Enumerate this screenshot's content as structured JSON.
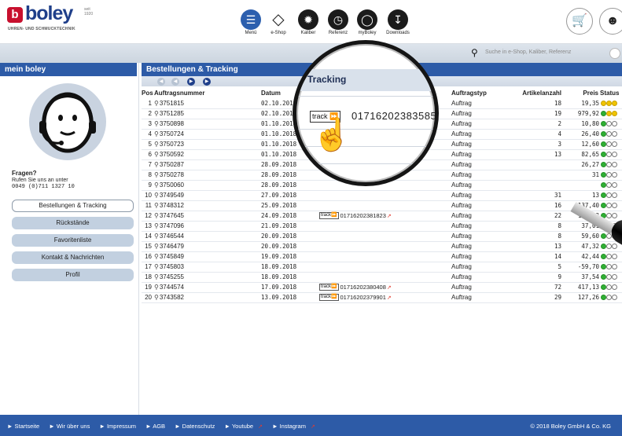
{
  "brand": {
    "logo_letter": "b",
    "name": "boley",
    "since": "seit 1920",
    "tagline": "UHREN- UND SCHMUCKTECHNIK",
    "color_primary": "#2d5ba7",
    "color_red": "#c8102e"
  },
  "nav": [
    {
      "label": "Menü",
      "icon": "menu-icon"
    },
    {
      "label": "e-Shop",
      "icon": "diamond-icon"
    },
    {
      "label": "Kaliber",
      "icon": "gear-icon"
    },
    {
      "label": "Referenz",
      "icon": "clock-icon"
    },
    {
      "label": "myBoley",
      "icon": "boley-o-icon"
    },
    {
      "label": "Downloads",
      "icon": "download-icon"
    }
  ],
  "header_buttons": [
    {
      "icon": "cart-icon"
    },
    {
      "icon": "user-icon"
    }
  ],
  "search": {
    "placeholder": "Suche in e-Shop, Kaliber, Referenz"
  },
  "sidebar": {
    "title": "mein boley",
    "help_title": "Fragen?",
    "help_text": "Rufen Sie uns an unter",
    "phone": "0049 (0)711 1327 10",
    "items": [
      {
        "label": "Bestellungen & Tracking",
        "active": true
      },
      {
        "label": "Rückstände",
        "active": false
      },
      {
        "label": "Favoritenliste",
        "active": false
      },
      {
        "label": "Kontakt & Nachrichten",
        "active": false
      },
      {
        "label": "Profil",
        "active": false
      }
    ]
  },
  "main": {
    "title": "Bestellungen & Tracking",
    "columns": {
      "pos": "Pos",
      "order": "Auftragsnummer",
      "date": "Datum",
      "type": "Auftragstyp",
      "count": "Artikelanzahl",
      "price": "Preis",
      "status": "Status"
    },
    "track_label": "track",
    "rows": [
      {
        "pos": "1",
        "order": "3751815",
        "date": "02.10.2018",
        "tracking": "",
        "type": "Auftrag",
        "count": "18",
        "price": "19,35",
        "status": [
          "y",
          "y",
          "y"
        ]
      },
      {
        "pos": "2",
        "order": "3751285",
        "date": "02.10.2018",
        "tracking": "",
        "type": "Auftrag",
        "count": "19",
        "price": "979,92",
        "status": [
          "g",
          "y",
          "y"
        ]
      },
      {
        "pos": "3",
        "order": "3750898",
        "date": "01.10.2018",
        "tracking": "",
        "type": "Auftrag",
        "count": "2",
        "price": "10,80",
        "status": [
          "g",
          "e",
          "e"
        ]
      },
      {
        "pos": "4",
        "order": "3750724",
        "date": "01.10.2018",
        "tracking": "",
        "type": "Auftrag",
        "count": "4",
        "price": "26,40",
        "status": [
          "g",
          "e",
          "e"
        ]
      },
      {
        "pos": "5",
        "order": "3750723",
        "date": "01.10.2018",
        "tracking": "",
        "type": "Auftrag",
        "count": "3",
        "price": "12,60",
        "status": [
          "g",
          "e",
          "e"
        ]
      },
      {
        "pos": "6",
        "order": "3750592",
        "date": "01.10.2018",
        "tracking": "",
        "type": "Auftrag",
        "count": "13",
        "price": "82,65",
        "status": [
          "g",
          "e",
          "e"
        ]
      },
      {
        "pos": "7",
        "order": "3750287",
        "date": "28.09.2018",
        "tracking": "",
        "type": "Auftrag",
        "count": "",
        "price": "26,27",
        "status": [
          "g",
          "e",
          "e"
        ]
      },
      {
        "pos": "8",
        "order": "3750278",
        "date": "28.09.2018",
        "tracking": "",
        "type": "Auftrag",
        "count": "",
        "price": "31",
        "status": [
          "g",
          "e",
          "e"
        ]
      },
      {
        "pos": "9",
        "order": "3750060",
        "date": "28.09.2018",
        "tracking": "",
        "type": "Auftrag",
        "count": "",
        "price": "",
        "status": [
          "g",
          "e",
          "e"
        ]
      },
      {
        "pos": "10",
        "order": "3749549",
        "date": "27.09.2018",
        "tracking": "",
        "type": "Auftrag",
        "count": "31",
        "price": "13",
        "status": [
          "g",
          "e",
          "e"
        ]
      },
      {
        "pos": "11",
        "order": "3748312",
        "date": "25.09.2018",
        "tracking": "",
        "type": "Auftrag",
        "count": "16",
        "price": "137,40",
        "status": [
          "g",
          "e",
          "e"
        ]
      },
      {
        "pos": "12",
        "order": "3747645",
        "date": "24.09.2018",
        "tracking": "01716202381823",
        "type": "Auftrag",
        "count": "22",
        "price": "166,63",
        "status": [
          "g",
          "e",
          "e"
        ]
      },
      {
        "pos": "13",
        "order": "3747096",
        "date": "21.09.2018",
        "tracking": "",
        "type": "Auftrag",
        "count": "8",
        "price": "37,01",
        "status": [
          "g",
          "e",
          "e"
        ]
      },
      {
        "pos": "14",
        "order": "3746544",
        "date": "20.09.2018",
        "tracking": "",
        "type": "Auftrag",
        "count": "8",
        "price": "59,60",
        "status": [
          "g",
          "e",
          "e"
        ]
      },
      {
        "pos": "15",
        "order": "3746479",
        "date": "20.09.2018",
        "tracking": "",
        "type": "Auftrag",
        "count": "13",
        "price": "47,32",
        "status": [
          "g",
          "e",
          "e"
        ]
      },
      {
        "pos": "16",
        "order": "3745849",
        "date": "19.09.2018",
        "tracking": "",
        "type": "Auftrag",
        "count": "14",
        "price": "42,44",
        "status": [
          "g",
          "e",
          "e"
        ]
      },
      {
        "pos": "17",
        "order": "3745803",
        "date": "18.09.2018",
        "tracking": "",
        "type": "Auftrag",
        "count": "5",
        "price": "-59,70",
        "status": [
          "g",
          "e",
          "e"
        ]
      },
      {
        "pos": "18",
        "order": "3745255",
        "date": "18.09.2018",
        "tracking": "",
        "type": "Auftrag",
        "count": "9",
        "price": "37,54",
        "status": [
          "g",
          "e",
          "e"
        ]
      },
      {
        "pos": "19",
        "order": "3744574",
        "date": "17.09.2018",
        "tracking": "01716202380408",
        "type": "Auftrag",
        "count": "72",
        "price": "417,13",
        "status": [
          "g",
          "e",
          "e"
        ]
      },
      {
        "pos": "20",
        "order": "3743582",
        "date": "13.09.2018",
        "tracking": "01716202379901",
        "type": "Auftrag",
        "count": "29",
        "price": "127,26",
        "status": [
          "g",
          "e",
          "e"
        ]
      }
    ]
  },
  "magnifier": {
    "title": "Tracking",
    "track_label": "track",
    "number": "01716202383585"
  },
  "footer": {
    "links": [
      "Startseite",
      "Wir über uns",
      "Impressum",
      "AGB",
      "Datenschutz",
      "Youtube",
      "Instagram"
    ],
    "copyright": "© 2018 Boley GmbH & Co. KG"
  }
}
